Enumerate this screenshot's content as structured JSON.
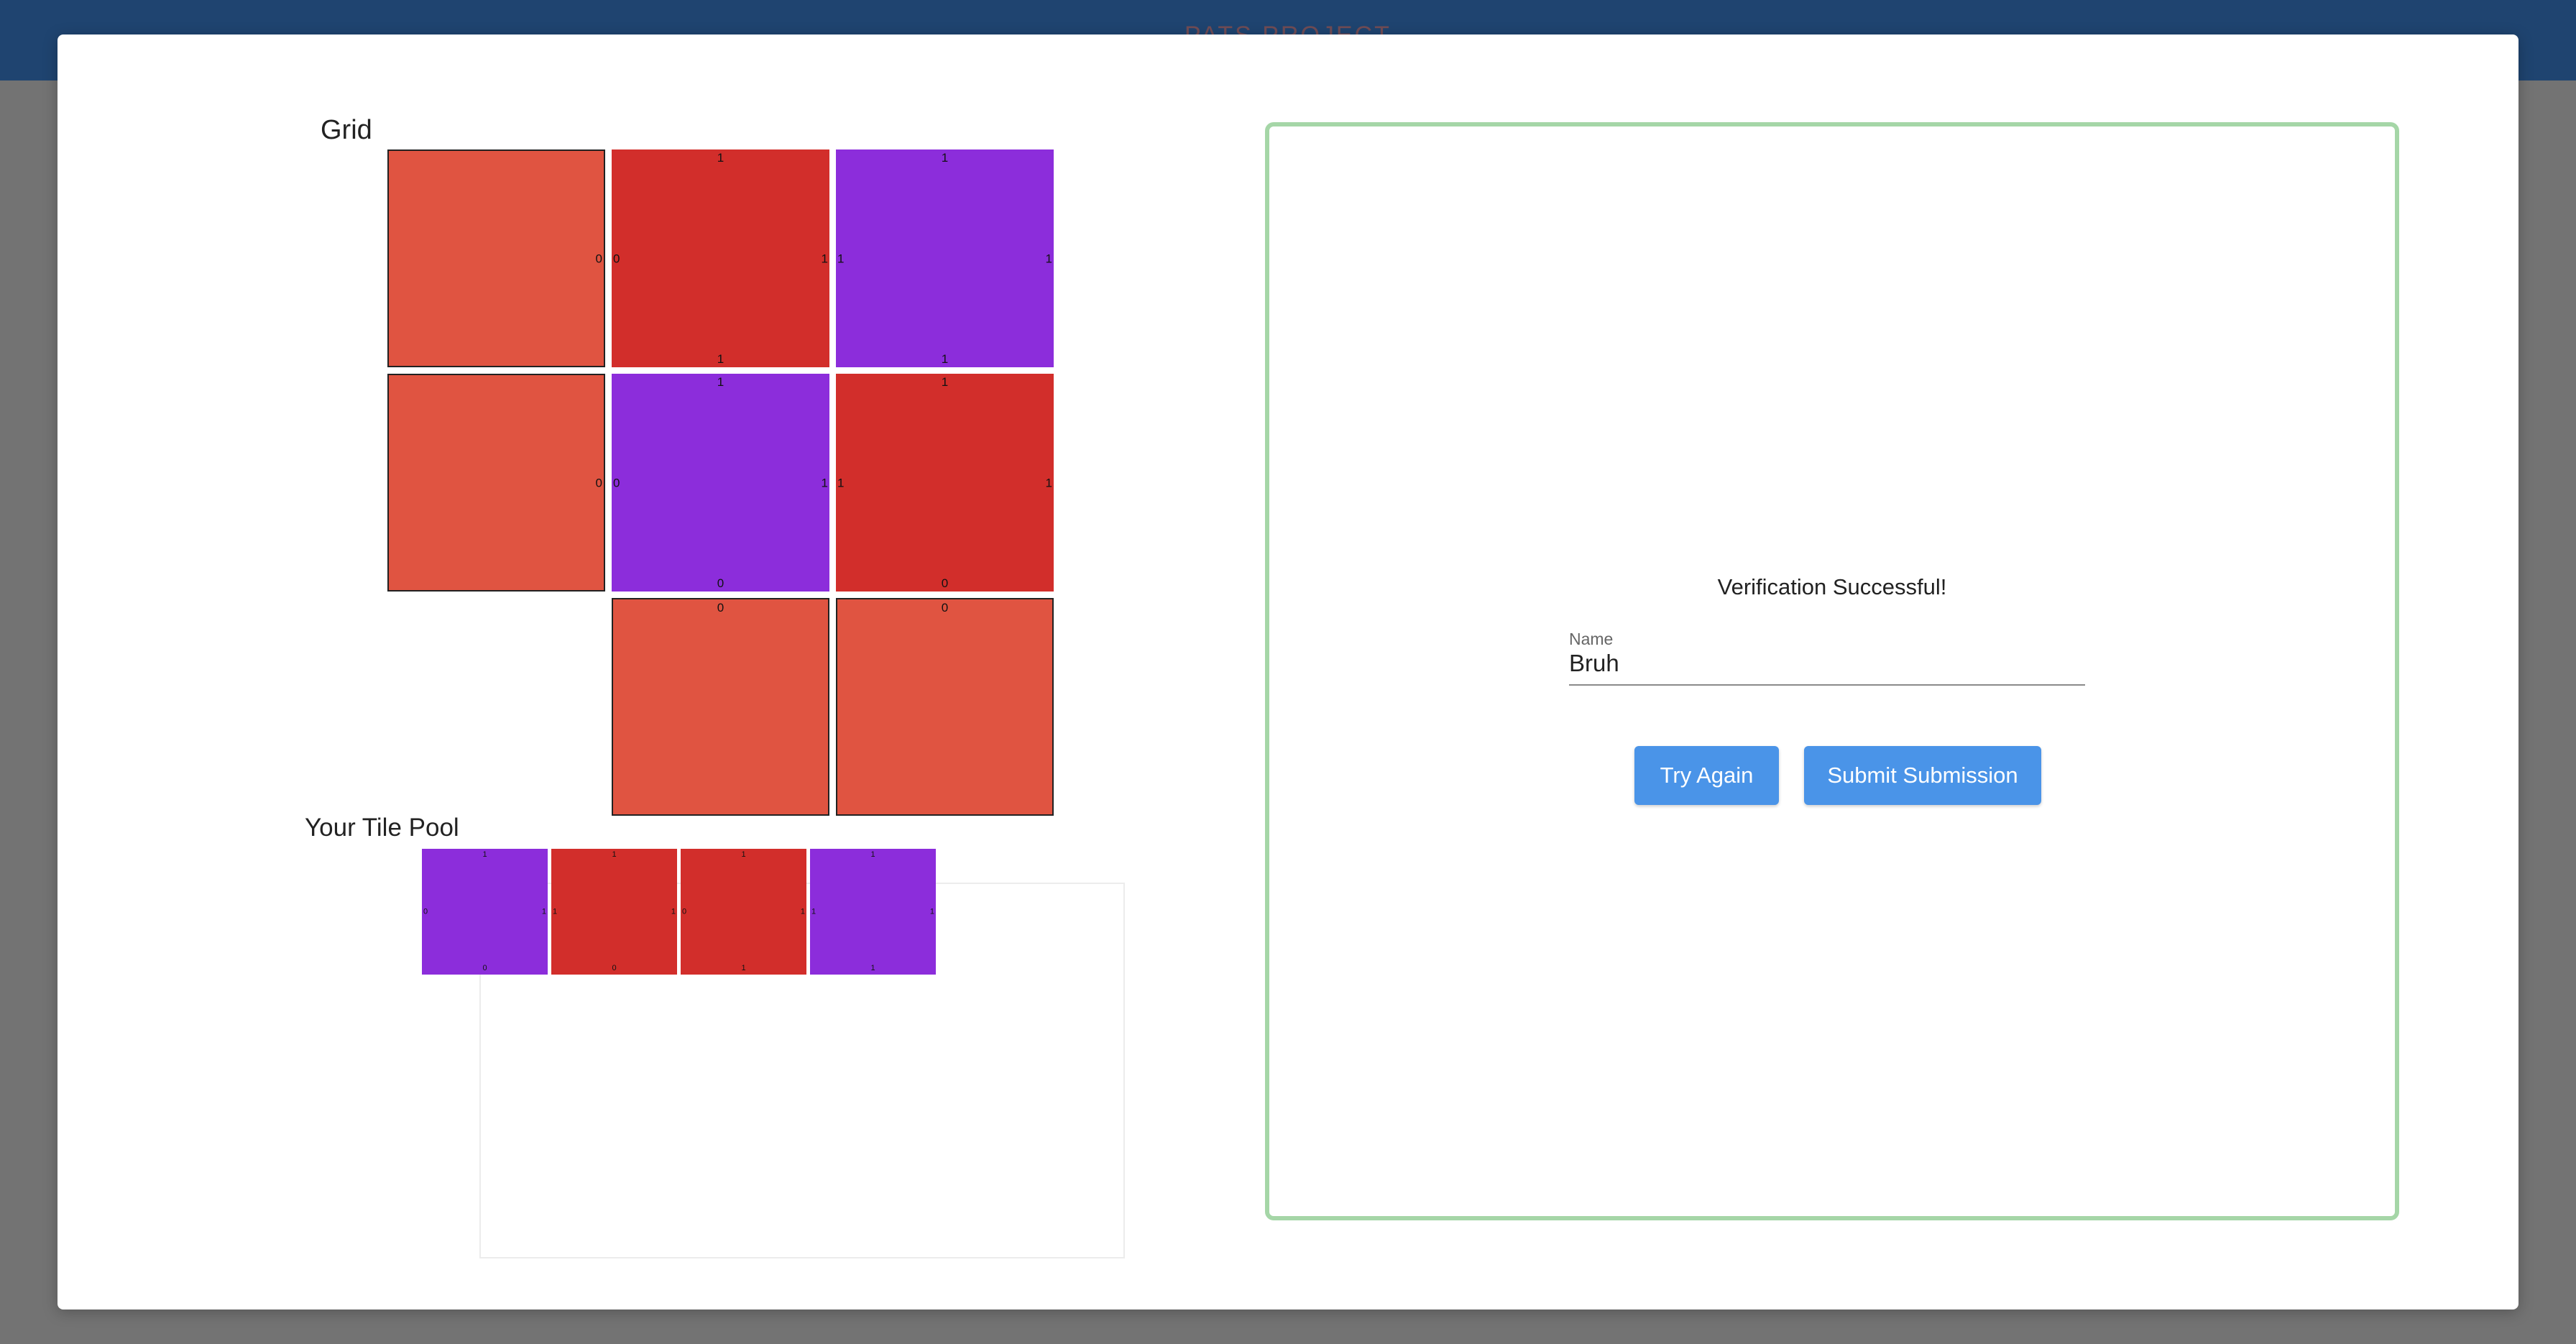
{
  "app": {
    "title": "PATS PROJECT"
  },
  "grid": {
    "label": "Grid",
    "tiles": [
      {
        "color": "#e05441",
        "top": "",
        "right": "0",
        "bottom": "",
        "left": "",
        "outlined": true
      },
      {
        "color": "#d22e2b",
        "top": "1",
        "right": "1",
        "bottom": "1",
        "left": "0",
        "outlined": false
      },
      {
        "color": "#8c2ddb",
        "top": "1",
        "right": "1",
        "bottom": "1",
        "left": "1",
        "outlined": false
      },
      {
        "color": "#e05441",
        "top": "",
        "right": "0",
        "bottom": "",
        "left": "",
        "outlined": true
      },
      {
        "color": "#8c2ddb",
        "top": "1",
        "right": "1",
        "bottom": "0",
        "left": "0",
        "outlined": false
      },
      {
        "color": "#d22e2b",
        "top": "1",
        "right": "1",
        "bottom": "0",
        "left": "1",
        "outlined": false
      },
      {
        "color": "#e05441",
        "top": "0",
        "right": "",
        "bottom": "",
        "left": "",
        "outlined": true
      },
      {
        "color": "#e05441",
        "top": "0",
        "right": "",
        "bottom": "",
        "left": "",
        "outlined": true
      }
    ]
  },
  "pool": {
    "label": "Your Tile Pool",
    "tiles": [
      {
        "color": "#8c2ddb",
        "top": "1",
        "right": "1",
        "bottom": "0",
        "left": "0"
      },
      {
        "color": "#d22e2b",
        "top": "1",
        "right": "1",
        "bottom": "0",
        "left": "1"
      },
      {
        "color": "#d22e2b",
        "top": "1",
        "right": "1",
        "bottom": "1",
        "left": "0"
      },
      {
        "color": "#8c2ddb",
        "top": "1",
        "right": "1",
        "bottom": "1",
        "left": "1"
      }
    ]
  },
  "verification": {
    "message": "Verification Successful!",
    "name_label": "Name",
    "name_value": "Bruh",
    "try_again_label": "Try Again",
    "submit_label": "Submit Submission",
    "accent_color": "#a5d6a7",
    "button_color": "#4a94e8"
  }
}
